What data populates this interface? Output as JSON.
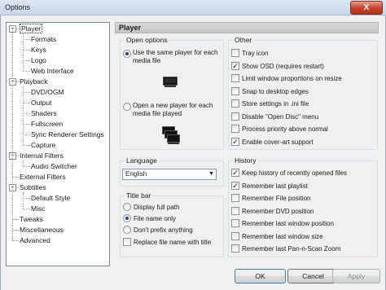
{
  "window": {
    "title": "Options",
    "close_glyph": "X"
  },
  "tree": {
    "items": [
      {
        "label": "Player",
        "level": 0,
        "expander": "−",
        "selected": true
      },
      {
        "label": "Formats",
        "level": 1
      },
      {
        "label": "Keys",
        "level": 1
      },
      {
        "label": "Logo",
        "level": 1
      },
      {
        "label": "Web Interface",
        "level": 1
      },
      {
        "label": "Playback",
        "level": 0,
        "expander": "−"
      },
      {
        "label": "DVD/OGM",
        "level": 1
      },
      {
        "label": "Output",
        "level": 1
      },
      {
        "label": "Shaders",
        "level": 1
      },
      {
        "label": "Fullscreen",
        "level": 1
      },
      {
        "label": "Sync Renderer Settings",
        "level": 1
      },
      {
        "label": "Capture",
        "level": 1
      },
      {
        "label": "Internal Filters",
        "level": 0,
        "expander": "−"
      },
      {
        "label": "Audio Switcher",
        "level": 1
      },
      {
        "label": "External Filters",
        "level": 0
      },
      {
        "label": "Subtitles",
        "level": 0,
        "expander": "−"
      },
      {
        "label": "Default Style",
        "level": 1
      },
      {
        "label": "Misc",
        "level": 1
      },
      {
        "label": "Tweaks",
        "level": 0
      },
      {
        "label": "Miscellaneous",
        "level": 0
      },
      {
        "label": "Advanced",
        "level": 0
      }
    ]
  },
  "panel": {
    "title": "Player"
  },
  "open_options": {
    "title": "Open options",
    "same_player": "Use the same player for each media file",
    "new_player": "Open a new player for each media file played",
    "selected": "same_player"
  },
  "language": {
    "title": "Language",
    "value": "English"
  },
  "title_bar": {
    "title": "Title bar",
    "options": [
      "Display full path",
      "File name only",
      "Don't prefix anything"
    ],
    "selected_index": 1,
    "replace_label": "Replace file name with title",
    "replace_checked": false
  },
  "other": {
    "title": "Other",
    "items": [
      {
        "label": "Tray icon",
        "checked": false
      },
      {
        "label": "Show OSD (requires restart)",
        "checked": true
      },
      {
        "label": "Limit window proportions on resize",
        "checked": false
      },
      {
        "label": "Snap to desktop edges",
        "checked": false
      },
      {
        "label": "Store settings in .ini file",
        "checked": false
      },
      {
        "label": "Disable \"Open Disc\" menu",
        "checked": false
      },
      {
        "label": "Process priority above normal",
        "checked": false
      },
      {
        "label": "Enable cover-art support",
        "checked": true
      }
    ]
  },
  "history": {
    "title": "History",
    "items": [
      {
        "label": "Keep history of recently opened files",
        "checked": true
      },
      {
        "label": "Remember last playlist",
        "checked": true
      },
      {
        "label": "Remember File position",
        "checked": false
      },
      {
        "label": "Remember DVD position",
        "checked": false
      },
      {
        "label": "Remember last window position",
        "checked": false
      },
      {
        "label": "Remember last window size",
        "checked": false
      },
      {
        "label": "Remember last Pan-n-Scan Zoom",
        "checked": false
      }
    ]
  },
  "buttons": {
    "ok": "OK",
    "cancel": "Cancel",
    "apply": "Apply"
  },
  "icons": [
    "monitor-single-icon",
    "monitor-multiple-icon",
    "checkmark-icon",
    "dropdown-arrow-icon"
  ]
}
